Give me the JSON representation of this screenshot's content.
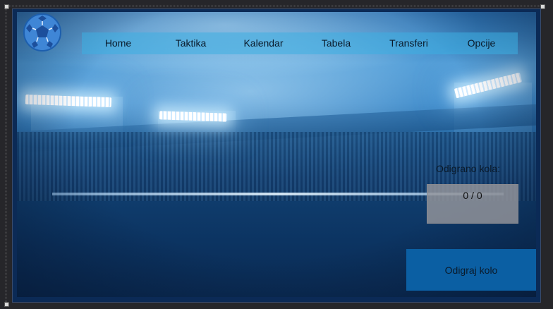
{
  "nav": {
    "items": [
      {
        "label": "Home"
      },
      {
        "label": "Taktika"
      },
      {
        "label": "Kalendar"
      },
      {
        "label": "Tabela"
      },
      {
        "label": "Transferi"
      },
      {
        "label": "Opcije"
      }
    ]
  },
  "logo": {
    "icon": "football-ball-icon"
  },
  "rounds": {
    "label": "Odigrano kola:",
    "value": "0 / 0"
  },
  "actions": {
    "play_label": "Odigraj kolo"
  },
  "colors": {
    "nav_bg": "#3cafe1",
    "button_bg": "#0b5fa3",
    "rounds_box_bg": "#96969b",
    "text": "#0a1a2a"
  }
}
